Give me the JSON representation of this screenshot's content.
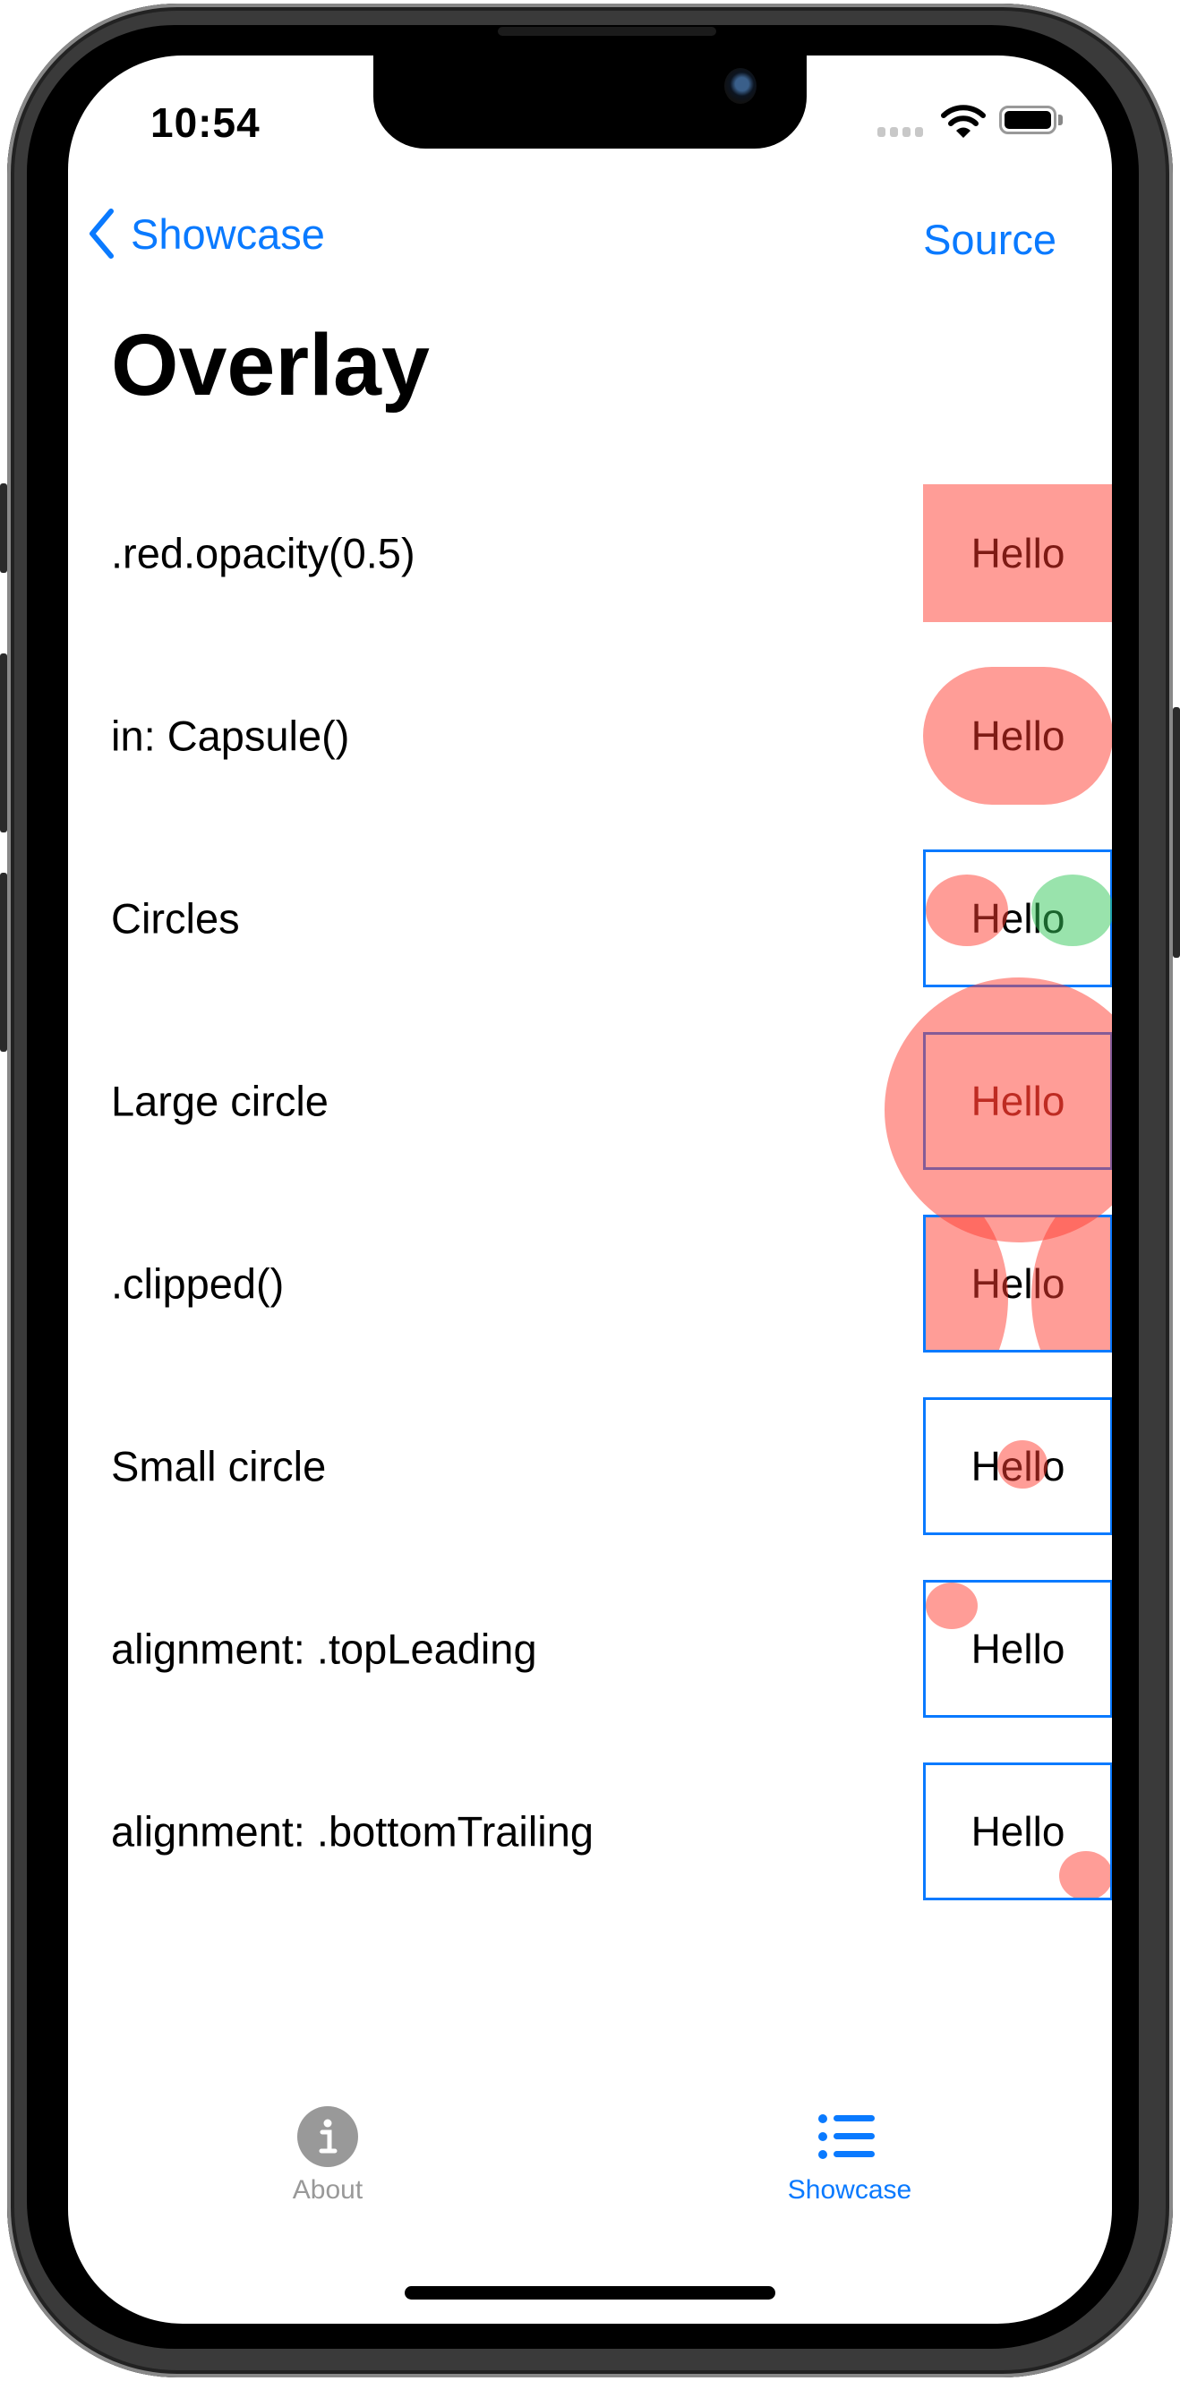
{
  "status_bar": {
    "time": "10:54"
  },
  "nav": {
    "back_label": "Showcase",
    "right_action_label": "Source"
  },
  "page": {
    "title": "Overlay"
  },
  "colors": {
    "accent": "#0a7aff",
    "overlay_red": "#ff3b30",
    "overlay_green": "#34c759",
    "tab_inactive": "#999999"
  },
  "rows": [
    {
      "label": ".red.opacity(0.5)",
      "demo_text": "Hello"
    },
    {
      "label": "in: Capsule()",
      "demo_text": "Hello"
    },
    {
      "label": "Circles",
      "demo_text": "Hello"
    },
    {
      "label": "Large circle",
      "demo_text": "Hello"
    },
    {
      "label": ".clipped()",
      "demo_text": "Hello"
    },
    {
      "label": "Small circle",
      "demo_text": "Hello"
    },
    {
      "label": "alignment: .topLeading",
      "demo_text": "Hello"
    },
    {
      "label": "alignment: .bottomTrailing",
      "demo_text": "Hello"
    }
  ],
  "tabbar": {
    "tabs": [
      {
        "label": "About",
        "icon": "info-circle-icon",
        "selected": false
      },
      {
        "label": "Showcase",
        "icon": "list-bullet-icon",
        "selected": true
      }
    ]
  }
}
